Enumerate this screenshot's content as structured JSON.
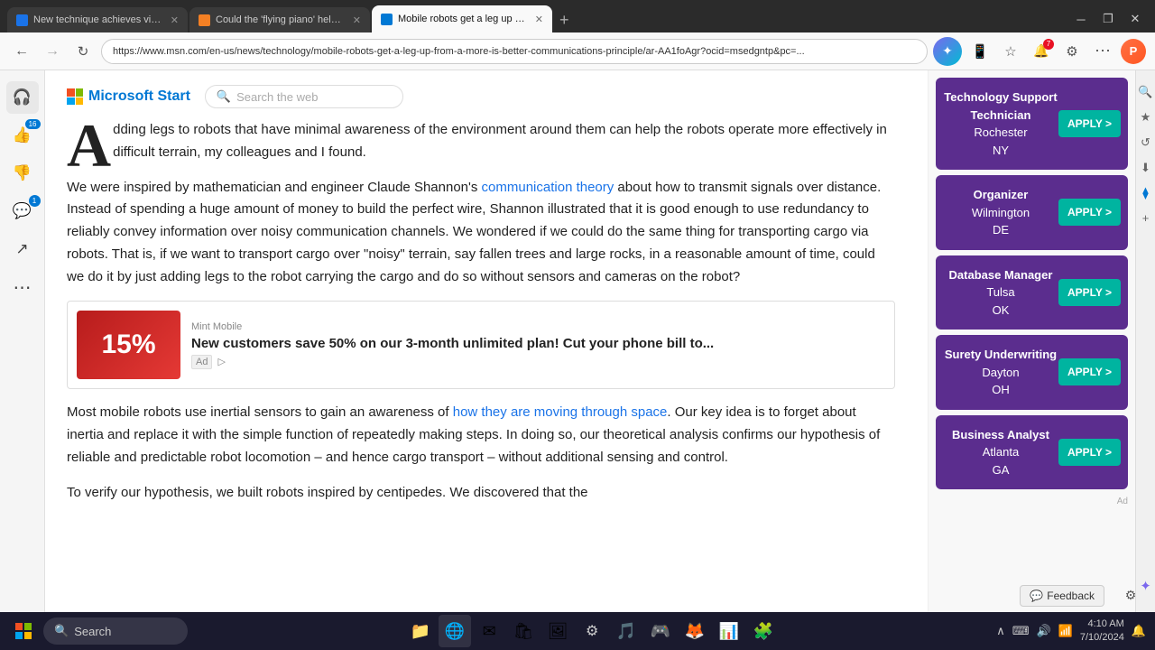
{
  "browser": {
    "tabs": [
      {
        "id": "tab1",
        "label": "New technique achieves visuali...",
        "favicon": "blue",
        "active": false
      },
      {
        "id": "tab2",
        "label": "Could the 'flying piano' help tra...",
        "favicon": "orange",
        "active": false
      },
      {
        "id": "tab3",
        "label": "Mobile robots get a leg up from...",
        "favicon": "msn",
        "active": true
      }
    ],
    "address": "https://www.msn.com/en-us/news/technology/mobile-robots-get-a-leg-up-from-a-more-is-better-communications-principle/ar-AA1foAgr?ocid=msedgntp&pc=..."
  },
  "article": {
    "drop_cap": "A",
    "para1_rest": "dding legs to robots that have minimal awareness of the environment around them can help the robots operate more effectively in difficult terrain, my colleagues and I found.",
    "para2": "We were inspired by mathematician and engineer Claude Shannon's ",
    "link1": "communication theory",
    "para2_cont": " about how to transmit signals over distance. Instead of spending a huge amount of money to build the perfect wire, Shannon illustrated that it is good enough to use redundancy to reliably convey information over noisy communication channels. We wondered if we could do the same thing for transporting cargo via robots. That is, if we want to transport cargo over \"noisy\" terrain, say fallen trees and large rocks, in a reasonable amount of time, could we do it by just adding legs to the robot carrying the cargo and do so without sensors and cameras on the robot?",
    "para3": "Most mobile robots use inertial sensors to gain an awareness of ",
    "link2": "how they are moving through space",
    "para3_cont": ". Our key idea is to forget about inertia and replace it with the simple function of repeatedly making steps. In doing so, our theoretical analysis confirms our hypothesis of reliable and predictable robot locomotion – and hence cargo transport – without additional sensing and control.",
    "para4": "To verify our hypothesis, we built robots inspired by centipedes. We discovered that the"
  },
  "ad": {
    "source": "Mint Mobile",
    "title": "New customers save 50% on our 3-month unlimited plan! Cut your phone bill to...",
    "ad_label": "Ad",
    "display_label": "▷"
  },
  "sidebar_left": {
    "icons": [
      {
        "name": "headset-icon",
        "symbol": "🎧",
        "badge": null
      },
      {
        "name": "thumbs-up-icon",
        "symbol": "👍",
        "badge": "16"
      },
      {
        "name": "thumbs-down-icon",
        "symbol": "👎",
        "badge": null
      },
      {
        "name": "comment-icon",
        "symbol": "💬",
        "badge": "1"
      },
      {
        "name": "share-icon",
        "symbol": "↗",
        "badge": null
      },
      {
        "name": "more-icon",
        "symbol": "⋮",
        "badge": null
      }
    ]
  },
  "jobs": [
    {
      "title": "Technology Support Technician",
      "location": "Rochester",
      "state": "NY",
      "apply_label": "APPLY >"
    },
    {
      "title": "Organizer",
      "location": "Wilmington",
      "state": "DE",
      "apply_label": "APPLY >"
    },
    {
      "title": "Database Manager",
      "location": "Tulsa",
      "state": "OK",
      "apply_label": "APPLY >"
    },
    {
      "title": "Surety Underwriting",
      "location": "Dayton",
      "state": "OH",
      "apply_label": "APPLY >"
    },
    {
      "title": "Business Analyst",
      "location": "Atlanta",
      "state": "GA",
      "apply_label": "APPLY >"
    }
  ],
  "feedback": {
    "label": "Feedback"
  },
  "taskbar": {
    "search_placeholder": "Search",
    "time": "4:10 AM",
    "date": "7/10/2024"
  },
  "msn": {
    "logo_text": "Microsoft Start",
    "search_placeholder": "Search the web"
  }
}
